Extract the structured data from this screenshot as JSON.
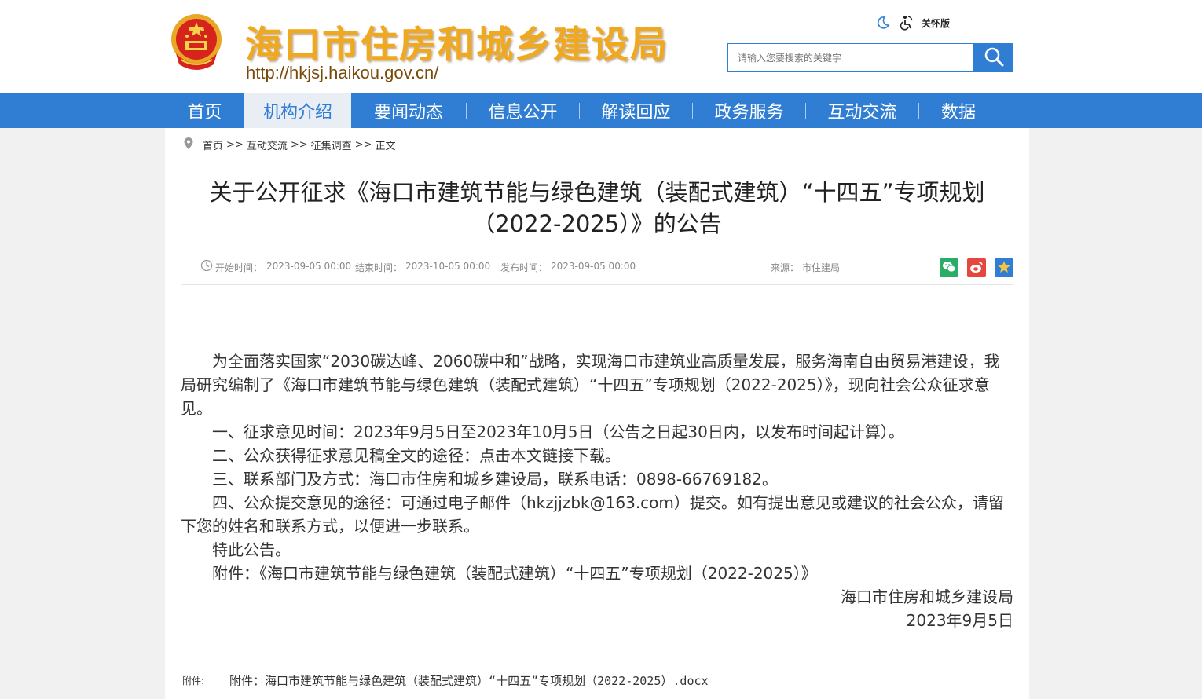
{
  "header": {
    "site_title": "海口市住房和城乡建设局",
    "site_url": "http://hkjsj.haikou.gov.cn/",
    "care_mode_label": "关怀版",
    "search_placeholder": "请输入您要搜索的关键字"
  },
  "nav": {
    "items": [
      {
        "label": "首页",
        "width": 101
      },
      {
        "label": "机构介绍",
        "width": 136,
        "active": true
      },
      {
        "label": "要闻动态",
        "width": 146
      },
      {
        "label": "信息公开",
        "width": 143
      },
      {
        "label": "解读回应",
        "width": 143
      },
      {
        "label": "政务服务",
        "width": 143
      },
      {
        "label": "互动交流",
        "width": 143
      },
      {
        "label": "数据",
        "width": 100
      }
    ]
  },
  "breadcrumb": [
    "首页",
    "互动交流",
    "征集调查",
    "正文"
  ],
  "breadcrumb_sep": ">>",
  "article": {
    "title_line1": "关于公开征求《海口市建筑节能与绿色建筑（装配式建筑）“十四五”专项规划",
    "title_line2": "（2022-2025）》的公告",
    "meta": {
      "start_label": "开始时间：",
      "start_value": "2023-09-05 00:00",
      "end_label": "结束时间：",
      "end_value": "2023-10-05 00:00",
      "publish_label": "发布时间：",
      "publish_value": "2023-09-05 00:00",
      "source_label": "来源：",
      "source_value": "市住建局"
    },
    "paragraphs": [
      "为全面落实国家“2030碳达峰、2060碳中和”战略，实现海口市建筑业高质量发展，服务海南自由贸易港建设，我局研究编制了《海口市建筑节能与绿色建筑（装配式建筑）“十四五”专项规划（2022-2025）》，现向社会公众征求意见。",
      "一、征求意见时间：2023年9月5日至2023年10月5日（公告之日起30日内，以发布时间起计算）。",
      "二、公众获得征求意见稿全文的途径：点击本文链接下载。",
      "三、联系部门及方式：海口市住房和城乡建设局，联系电话：0898-66769182。",
      "四、公众提交意见的途径：可通过电子邮件（hkzjjzbk@163.com）提交。如有提出意见或建议的社会公众，请留下您的姓名和联系方式，以便进一步联系。",
      "特此公告。",
      "附件：《海口市建筑节能与绿色建筑（装配式建筑）“十四五”专项规划（2022-2025）》"
    ],
    "signature_org": "海口市住房和城乡建设局",
    "signature_date": "2023年9月5日",
    "attachment_label": "附件:",
    "attachment_link": "附件：海口市建筑节能与绿色建筑（装配式建筑）“十四五”专项规划（2022-2025）.docx"
  },
  "colors": {
    "brand_blue": "#2f7ed3",
    "title_gold": "#f0a81e",
    "wechat_green": "#2aae67",
    "weibo_red": "#e6463d",
    "fav_blue": "#2f7ed3"
  }
}
